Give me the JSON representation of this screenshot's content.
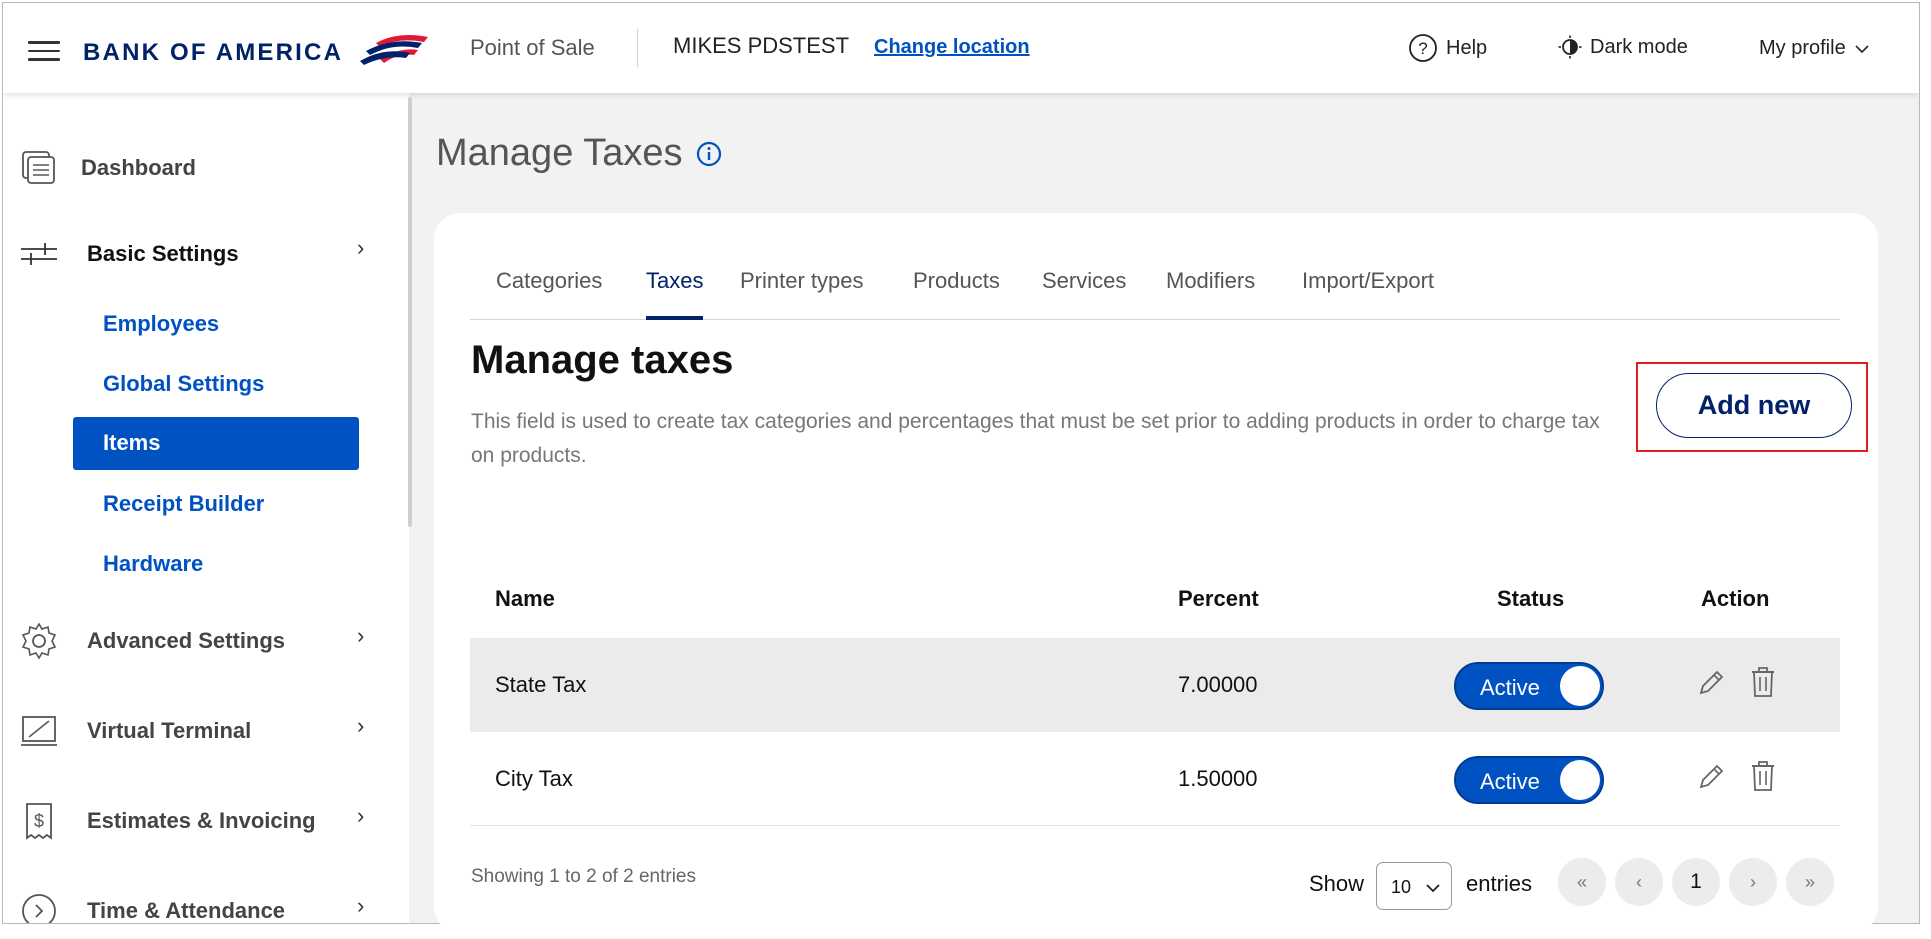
{
  "header": {
    "brand": "BANK OF AMERICA",
    "app_name": "Point of Sale",
    "merchant": "MIKES PDSTEST",
    "change_location": "Change location",
    "help": "Help",
    "dark_mode": "Dark mode",
    "profile": "My profile"
  },
  "sidebar": {
    "dashboard": "Dashboard",
    "basic_settings": "Basic Settings",
    "sub_items": [
      "Employees",
      "Global Settings",
      "Items",
      "Receipt Builder",
      "Hardware"
    ],
    "advanced_settings": "Advanced Settings",
    "virtual_terminal": "Virtual Terminal",
    "estimates": "Estimates & Invoicing",
    "time_attendance": "Time & Attendance"
  },
  "page": {
    "title": "Manage Taxes",
    "tabs": [
      "Categories",
      "Taxes",
      "Printer types",
      "Products",
      "Services",
      "Modifiers",
      "Import/Export"
    ],
    "active_tab": "Taxes",
    "section_title": "Manage taxes",
    "section_desc": "This field is used to create tax categories and percentages that must be set prior to adding products in order to charge tax on products.",
    "add_new": "Add new"
  },
  "table": {
    "columns": [
      "Name",
      "Percent",
      "Status",
      "Action"
    ],
    "rows": [
      {
        "name": "State Tax",
        "percent": "7.00000",
        "status": "Active"
      },
      {
        "name": "City Tax",
        "percent": "1.50000",
        "status": "Active"
      }
    ]
  },
  "footer": {
    "showing": "Showing 1 to 2 of 2 entries",
    "show": "Show",
    "per_page": "10",
    "entries": "entries",
    "pager": {
      "first": "«",
      "prev": "‹",
      "current": "1",
      "next": "›",
      "last": "»"
    }
  },
  "colors": {
    "brand_navy": "#012169",
    "accent_blue": "#0052c2",
    "flag_red": "#e31837",
    "highlight": "#e21d24"
  }
}
